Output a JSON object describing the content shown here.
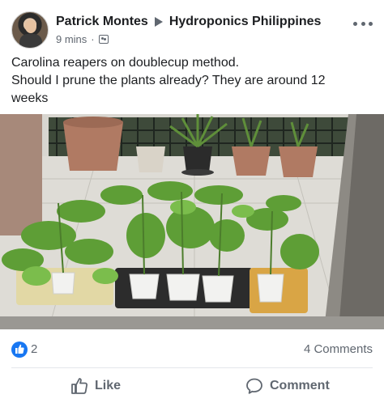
{
  "post": {
    "author": "Patrick Montes",
    "group": "Hydroponics Philippines",
    "time": "9 mins",
    "separator": "·",
    "lines": [
      "Carolina reapers on doublecup method.",
      "Should I prune the plants already? They are around 12",
      "weeks"
    ]
  },
  "engagement": {
    "reaction_count": "2",
    "comment_count": "4 Comments"
  },
  "actions": {
    "like_label": "Like",
    "comment_label": "Comment"
  },
  "colors": {
    "accent": "#1877f2",
    "secondary_text": "#606770",
    "primary_text": "#1c1e21"
  },
  "icons": {
    "more": "more-options-icon",
    "privacy": "group-privacy-icon",
    "like_reaction": "thumbs-up-icon",
    "like_action": "like-outline-icon",
    "comment_action": "comment-bubble-icon"
  }
}
